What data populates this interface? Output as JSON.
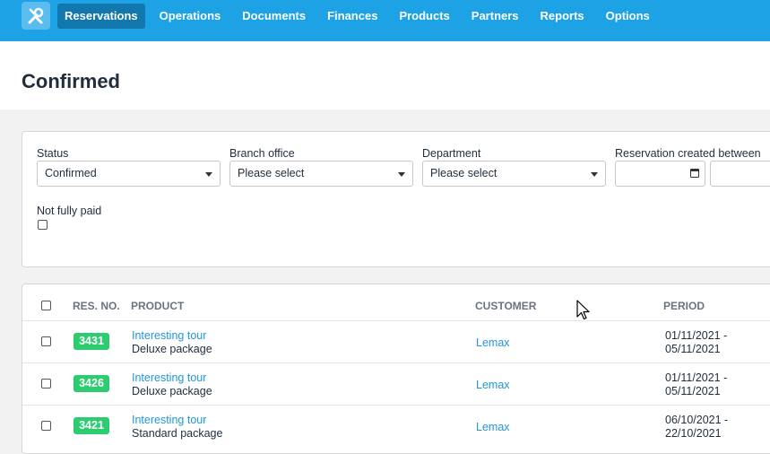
{
  "nav": {
    "items": [
      {
        "label": "Reservations",
        "active": true
      },
      {
        "label": "Operations"
      },
      {
        "label": "Documents"
      },
      {
        "label": "Finances"
      },
      {
        "label": "Products"
      },
      {
        "label": "Partners"
      },
      {
        "label": "Reports"
      },
      {
        "label": "Options"
      }
    ]
  },
  "page": {
    "title": "Confirmed"
  },
  "filters": {
    "status": {
      "label": "Status",
      "value": "Confirmed"
    },
    "branch": {
      "label": "Branch office",
      "value": "Please select"
    },
    "department": {
      "label": "Department",
      "value": "Please select"
    },
    "created": {
      "label": "Reservation created between"
    },
    "not_fully_paid": {
      "label": "Not fully paid",
      "checked": false
    }
  },
  "table": {
    "headers": {
      "res_no": "RES. NO.",
      "product": "PRODUCT",
      "customer": "CUSTOMER",
      "period": "PERIOD"
    },
    "rows": [
      {
        "res_no": "3431",
        "product": "Interesting tour",
        "package": "Deluxe package",
        "customer": "Lemax",
        "period_start": "01/11/2021 -",
        "period_end": "05/11/2021"
      },
      {
        "res_no": "3426",
        "product": "Interesting tour",
        "package": "Deluxe package",
        "customer": "Lemax",
        "period_start": "01/11/2021 -",
        "period_end": "05/11/2021"
      },
      {
        "res_no": "3421",
        "product": "Interesting tour",
        "package": "Standard package",
        "customer": "Lemax",
        "period_start": "06/10/2021 -",
        "period_end": "22/10/2021"
      }
    ]
  },
  "colors": {
    "topbar": "#1ea2e6",
    "active_nav": "#1277ad",
    "badge": "#2ecc71",
    "link": "#2196d8"
  },
  "icons": {
    "logo": "tools-icon"
  }
}
